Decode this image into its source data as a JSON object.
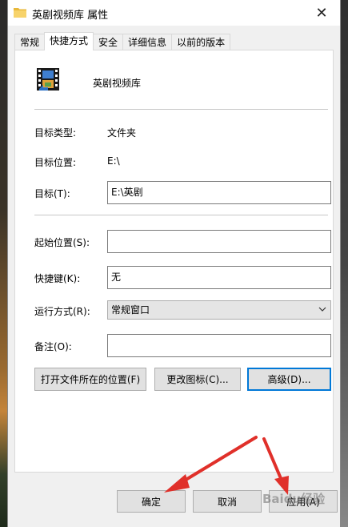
{
  "window": {
    "title": "英剧视频库 属性",
    "close_glyph": "✕"
  },
  "tabs": [
    {
      "label": "常规"
    },
    {
      "label": "快捷方式"
    },
    {
      "label": "安全"
    },
    {
      "label": "详细信息"
    },
    {
      "label": "以前的版本"
    }
  ],
  "shortcut": {
    "name": "英剧视频库",
    "target_type_label": "目标类型:",
    "target_type_value": "文件夹",
    "target_location_label": "目标位置:",
    "target_location_value": "E:\\",
    "target_label": "目标(T):",
    "target_value": "E:\\英剧",
    "start_in_label": "起始位置(S):",
    "start_in_value": "",
    "hotkey_label": "快捷键(K):",
    "hotkey_value": "无",
    "run_label": "运行方式(R):",
    "run_value": "常规窗口",
    "comment_label": "备注(O):",
    "comment_value": "",
    "open_location_button": "打开文件所在的位置(F)",
    "change_icon_button": "更改图标(C)...",
    "advanced_button": "高级(D)..."
  },
  "footer": {
    "ok": "确定",
    "cancel": "取消",
    "apply": "应用(A)"
  },
  "watermark": "Baidu经验",
  "colors": {
    "focus_border": "#0078d7",
    "arrow": "#e0302a"
  }
}
